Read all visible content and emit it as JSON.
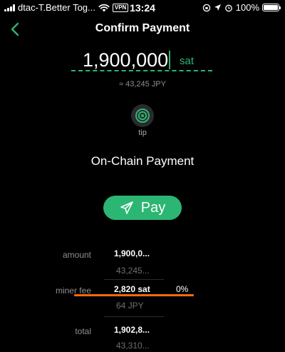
{
  "status_bar": {
    "carrier": "dtac-T.Better Tog...",
    "vpn": "VPN",
    "time": "13:24",
    "battery": "100%",
    "battery_level": 1.0
  },
  "header": {
    "title": "Confirm Payment",
    "back_icon": "chevron-left-icon"
  },
  "amount": {
    "value": "1,900,000",
    "unit": "sat",
    "fiat": "≈ 43,245 JPY"
  },
  "tip": {
    "label": "tip",
    "icon": "target-icon"
  },
  "payment_type": "On-Chain Payment",
  "pay_button": {
    "label": "Pay",
    "icon": "send-icon"
  },
  "summary": {
    "amount": {
      "label": "amount",
      "value": "1,900,0...",
      "fiat": "43,245..."
    },
    "miner_fee": {
      "label": "miner fee",
      "value": "2,820 sat",
      "percent": "0%",
      "fiat": "64 JPY"
    },
    "total": {
      "label": "total",
      "value": "1,902,8...",
      "fiat": "43,310..."
    }
  },
  "colors": {
    "accent": "#2bb673",
    "background": "#000000",
    "highlight": "#f26a10"
  }
}
